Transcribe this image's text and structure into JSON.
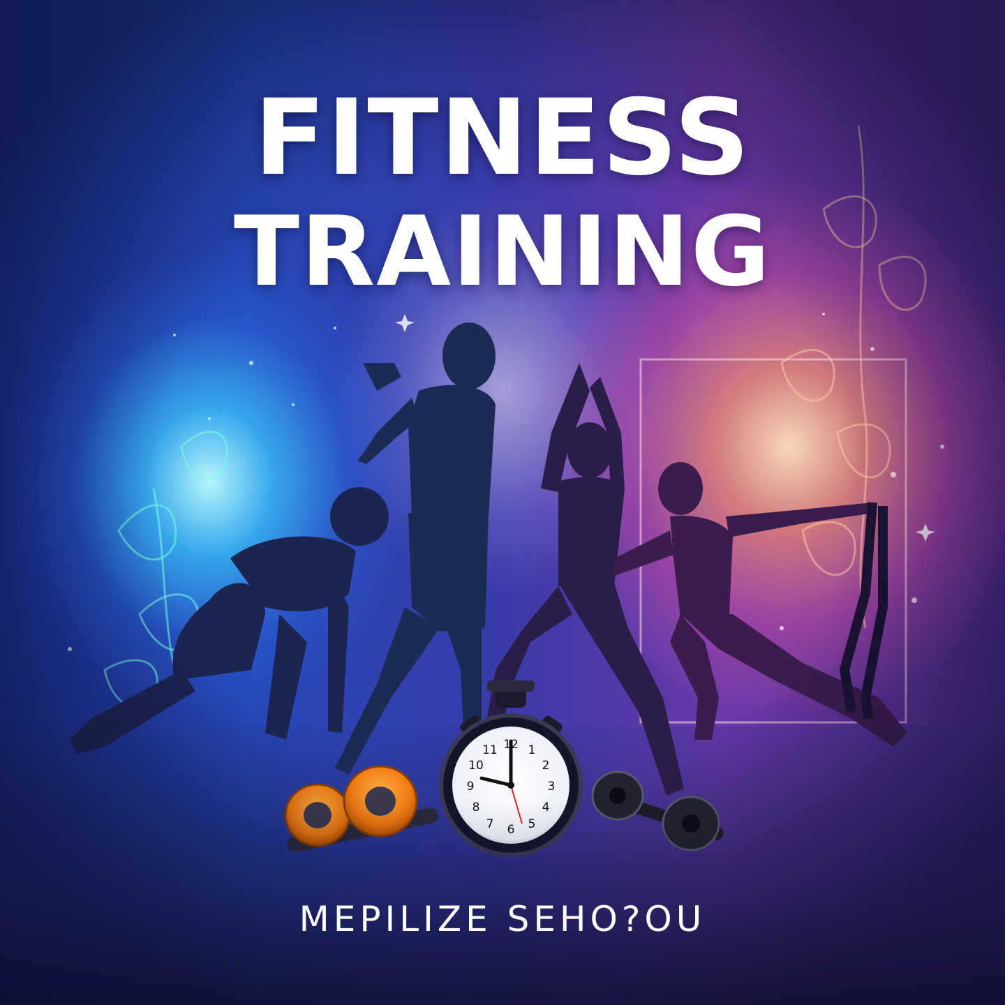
{
  "title": {
    "line1": "FITNESS",
    "line2": "TRAINING"
  },
  "brand": "MEPILIZE SEHO?OU",
  "stopwatch": {
    "numerals": [
      "12",
      "1",
      "2",
      "3",
      "4",
      "5",
      "6",
      "7",
      "8",
      "9",
      "10",
      "11"
    ]
  },
  "icons": [
    "stopwatch-icon",
    "dumbbell-icon",
    "resistance-band-icon",
    "sparkle-icon"
  ],
  "colors": {
    "accent_blue": "#3fd0ff",
    "accent_pink": "#ff6ab0",
    "accent_orange": "#ff8a1c",
    "text": "#ffffff"
  }
}
